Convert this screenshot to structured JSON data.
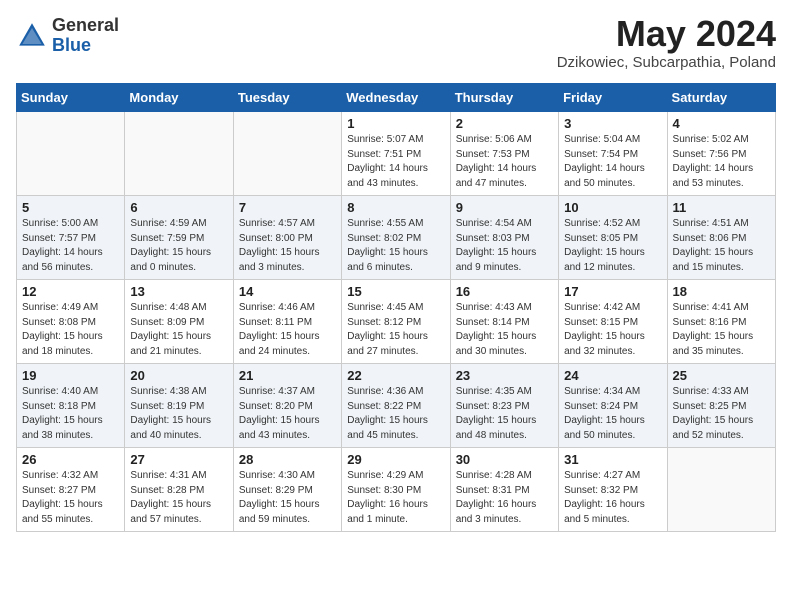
{
  "header": {
    "logo_general": "General",
    "logo_blue": "Blue",
    "month_title": "May 2024",
    "subtitle": "Dzikowiec, Subcarpathia, Poland"
  },
  "weekdays": [
    "Sunday",
    "Monday",
    "Tuesday",
    "Wednesday",
    "Thursday",
    "Friday",
    "Saturday"
  ],
  "weeks": [
    [
      {
        "day": "",
        "info": ""
      },
      {
        "day": "",
        "info": ""
      },
      {
        "day": "",
        "info": ""
      },
      {
        "day": "1",
        "info": "Sunrise: 5:07 AM\nSunset: 7:51 PM\nDaylight: 14 hours\nand 43 minutes."
      },
      {
        "day": "2",
        "info": "Sunrise: 5:06 AM\nSunset: 7:53 PM\nDaylight: 14 hours\nand 47 minutes."
      },
      {
        "day": "3",
        "info": "Sunrise: 5:04 AM\nSunset: 7:54 PM\nDaylight: 14 hours\nand 50 minutes."
      },
      {
        "day": "4",
        "info": "Sunrise: 5:02 AM\nSunset: 7:56 PM\nDaylight: 14 hours\nand 53 minutes."
      }
    ],
    [
      {
        "day": "5",
        "info": "Sunrise: 5:00 AM\nSunset: 7:57 PM\nDaylight: 14 hours\nand 56 minutes."
      },
      {
        "day": "6",
        "info": "Sunrise: 4:59 AM\nSunset: 7:59 PM\nDaylight: 15 hours\nand 0 minutes."
      },
      {
        "day": "7",
        "info": "Sunrise: 4:57 AM\nSunset: 8:00 PM\nDaylight: 15 hours\nand 3 minutes."
      },
      {
        "day": "8",
        "info": "Sunrise: 4:55 AM\nSunset: 8:02 PM\nDaylight: 15 hours\nand 6 minutes."
      },
      {
        "day": "9",
        "info": "Sunrise: 4:54 AM\nSunset: 8:03 PM\nDaylight: 15 hours\nand 9 minutes."
      },
      {
        "day": "10",
        "info": "Sunrise: 4:52 AM\nSunset: 8:05 PM\nDaylight: 15 hours\nand 12 minutes."
      },
      {
        "day": "11",
        "info": "Sunrise: 4:51 AM\nSunset: 8:06 PM\nDaylight: 15 hours\nand 15 minutes."
      }
    ],
    [
      {
        "day": "12",
        "info": "Sunrise: 4:49 AM\nSunset: 8:08 PM\nDaylight: 15 hours\nand 18 minutes."
      },
      {
        "day": "13",
        "info": "Sunrise: 4:48 AM\nSunset: 8:09 PM\nDaylight: 15 hours\nand 21 minutes."
      },
      {
        "day": "14",
        "info": "Sunrise: 4:46 AM\nSunset: 8:11 PM\nDaylight: 15 hours\nand 24 minutes."
      },
      {
        "day": "15",
        "info": "Sunrise: 4:45 AM\nSunset: 8:12 PM\nDaylight: 15 hours\nand 27 minutes."
      },
      {
        "day": "16",
        "info": "Sunrise: 4:43 AM\nSunset: 8:14 PM\nDaylight: 15 hours\nand 30 minutes."
      },
      {
        "day": "17",
        "info": "Sunrise: 4:42 AM\nSunset: 8:15 PM\nDaylight: 15 hours\nand 32 minutes."
      },
      {
        "day": "18",
        "info": "Sunrise: 4:41 AM\nSunset: 8:16 PM\nDaylight: 15 hours\nand 35 minutes."
      }
    ],
    [
      {
        "day": "19",
        "info": "Sunrise: 4:40 AM\nSunset: 8:18 PM\nDaylight: 15 hours\nand 38 minutes."
      },
      {
        "day": "20",
        "info": "Sunrise: 4:38 AM\nSunset: 8:19 PM\nDaylight: 15 hours\nand 40 minutes."
      },
      {
        "day": "21",
        "info": "Sunrise: 4:37 AM\nSunset: 8:20 PM\nDaylight: 15 hours\nand 43 minutes."
      },
      {
        "day": "22",
        "info": "Sunrise: 4:36 AM\nSunset: 8:22 PM\nDaylight: 15 hours\nand 45 minutes."
      },
      {
        "day": "23",
        "info": "Sunrise: 4:35 AM\nSunset: 8:23 PM\nDaylight: 15 hours\nand 48 minutes."
      },
      {
        "day": "24",
        "info": "Sunrise: 4:34 AM\nSunset: 8:24 PM\nDaylight: 15 hours\nand 50 minutes."
      },
      {
        "day": "25",
        "info": "Sunrise: 4:33 AM\nSunset: 8:25 PM\nDaylight: 15 hours\nand 52 minutes."
      }
    ],
    [
      {
        "day": "26",
        "info": "Sunrise: 4:32 AM\nSunset: 8:27 PM\nDaylight: 15 hours\nand 55 minutes."
      },
      {
        "day": "27",
        "info": "Sunrise: 4:31 AM\nSunset: 8:28 PM\nDaylight: 15 hours\nand 57 minutes."
      },
      {
        "day": "28",
        "info": "Sunrise: 4:30 AM\nSunset: 8:29 PM\nDaylight: 15 hours\nand 59 minutes."
      },
      {
        "day": "29",
        "info": "Sunrise: 4:29 AM\nSunset: 8:30 PM\nDaylight: 16 hours\nand 1 minute."
      },
      {
        "day": "30",
        "info": "Sunrise: 4:28 AM\nSunset: 8:31 PM\nDaylight: 16 hours\nand 3 minutes."
      },
      {
        "day": "31",
        "info": "Sunrise: 4:27 AM\nSunset: 8:32 PM\nDaylight: 16 hours\nand 5 minutes."
      },
      {
        "day": "",
        "info": ""
      }
    ]
  ]
}
